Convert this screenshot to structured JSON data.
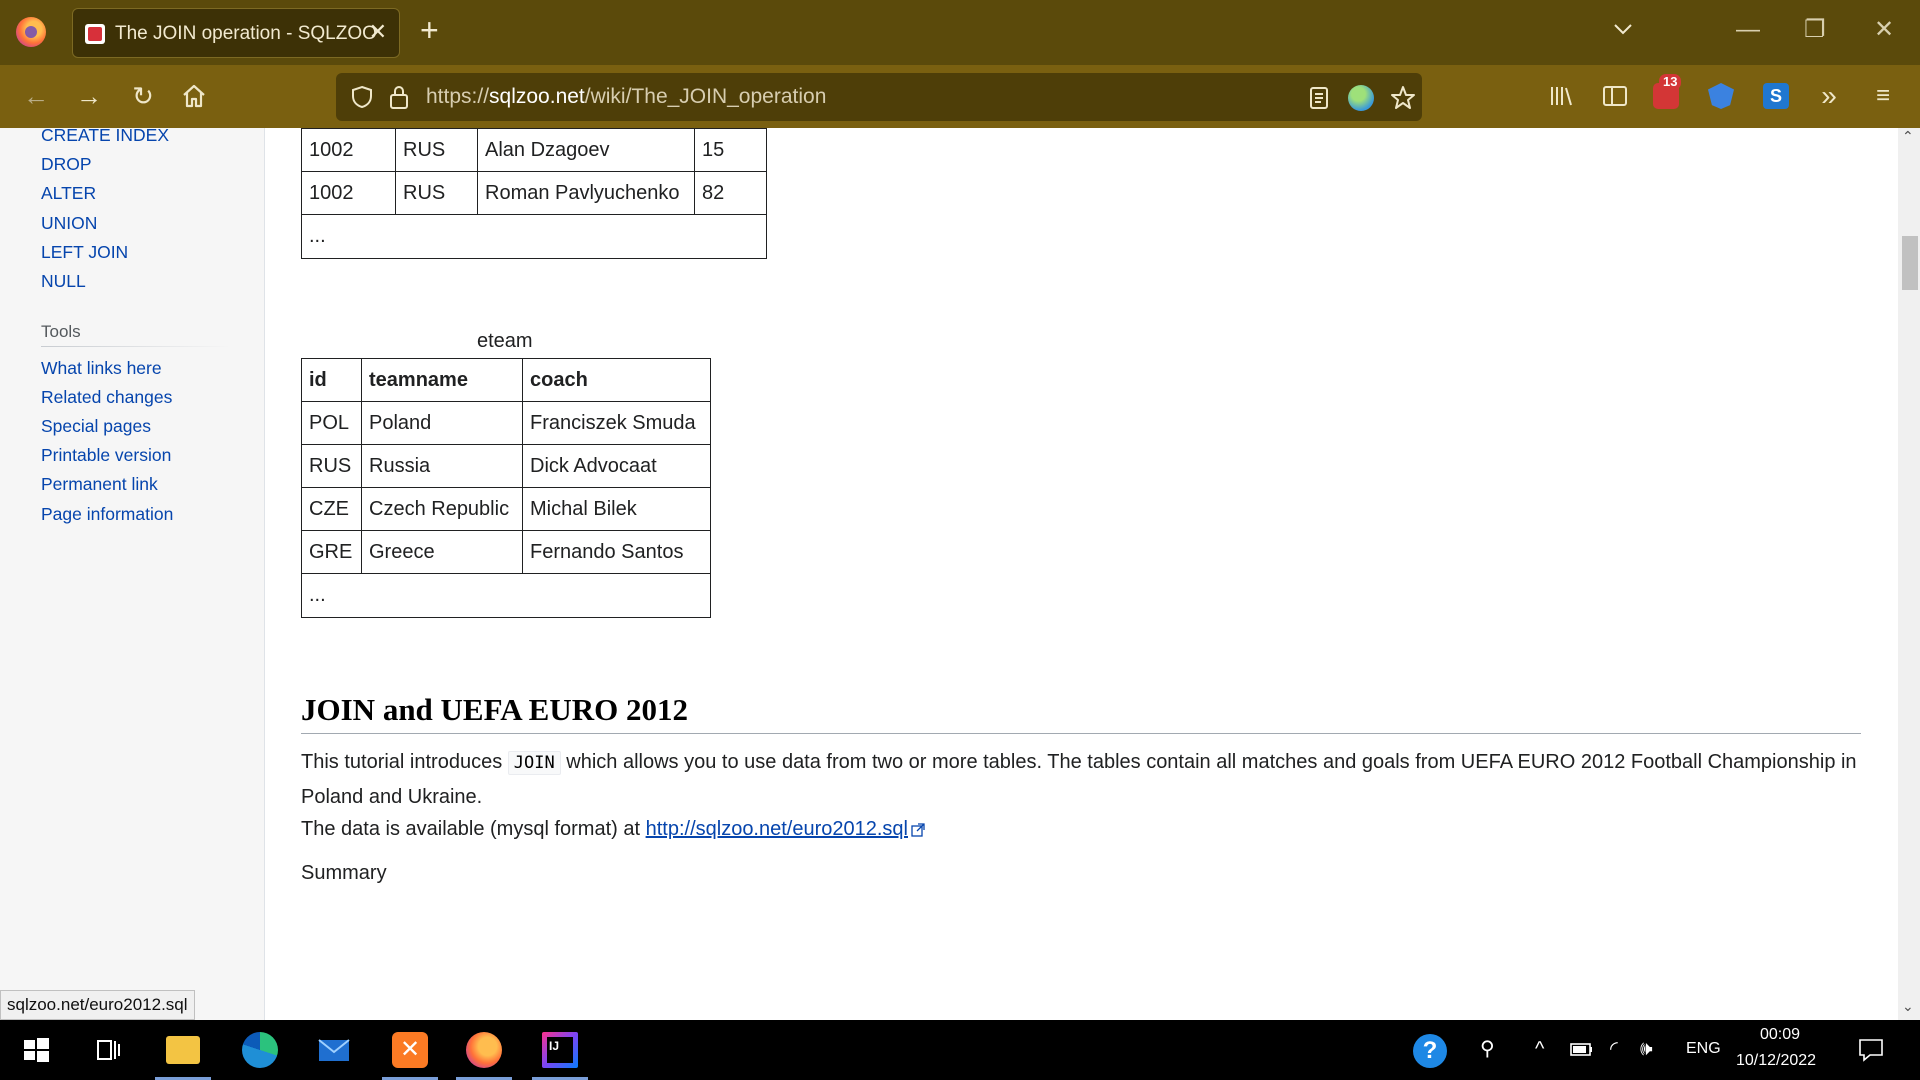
{
  "browser": {
    "tab_title": "The JOIN operation - SQLZOO",
    "tab_close": "✕",
    "new_tab": "+",
    "url_prefix": "https://",
    "url_host": "sqlzoo.net",
    "url_path": "/wiki/The_JOIN_operation",
    "extension_badge": "13",
    "window_controls": {
      "minimize": "—",
      "restore": "❐",
      "close": "✕"
    }
  },
  "sidebar": {
    "nav_links": [
      "CREATE INDEX",
      "DROP",
      "ALTER",
      "UNION",
      "LEFT JOIN",
      "NULL"
    ],
    "tools_heading": "Tools",
    "tools_links": [
      "What links here",
      "Related changes",
      "Special pages",
      "Printable version",
      "Permanent link",
      "Page information"
    ]
  },
  "goal_table": {
    "rows": [
      [
        "1002",
        "RUS",
        "Alan Dzagoev",
        "15"
      ],
      [
        "1002",
        "RUS",
        "Roman Pavlyuchenko",
        "82"
      ]
    ],
    "ellipsis": "..."
  },
  "eteam_table": {
    "caption": "eteam",
    "headers": [
      "id",
      "teamname",
      "coach"
    ],
    "rows": [
      [
        "POL",
        "Poland",
        "Franciszek Smuda"
      ],
      [
        "RUS",
        "Russia",
        "Dick Advocaat"
      ],
      [
        "CZE",
        "Czech Republic",
        "Michal Bilek"
      ],
      [
        "GRE",
        "Greece",
        "Fernando Santos"
      ]
    ],
    "ellipsis": "..."
  },
  "section": {
    "heading": "JOIN and UEFA EURO 2012",
    "para1_before": "This tutorial introduces ",
    "para1_code": "JOIN",
    "para1_after": " which allows you to use data from two or more tables. The tables contain all matches and goals from UEFA EURO 2012 Football Championship in Poland and Ukraine.",
    "para2_before": "The data is available (mysql format) at ",
    "para2_link": "http://sqlzoo.net/euro2012.sql",
    "summary": "Summary"
  },
  "status_bar": "sqlzoo.net/euro2012.sql",
  "taskbar": {
    "language": "ENG",
    "time": "00:09",
    "date": "10/12/2022"
  }
}
